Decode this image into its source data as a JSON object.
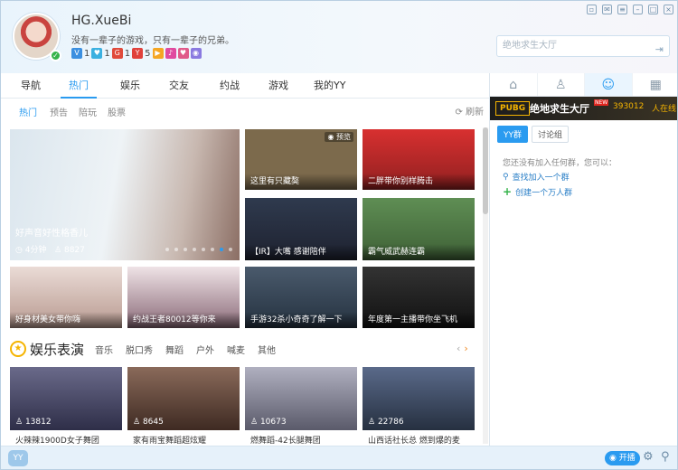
{
  "user": {
    "name": "HG.XueBi",
    "signature": "没有一辈子的游戏，只有一辈子的兄弟。",
    "badges": [
      "1",
      "1",
      "1",
      "5"
    ]
  },
  "search": {
    "placeholder": "绝地求生大厅"
  },
  "nav": {
    "items": [
      "导航",
      "热门",
      "娱乐",
      "交友",
      "约战",
      "游戏",
      "我的YY"
    ],
    "active": "热门"
  },
  "subnav": {
    "items": [
      "热门",
      "预告",
      "陪玩",
      "股票"
    ],
    "active": "热门",
    "refresh_label": "刷新"
  },
  "featured": {
    "title": "好声音好性格香儿",
    "duration": "4分钟",
    "viewers": "8827"
  },
  "tiles": [
    {
      "title": "这里有只藏獒",
      "tag": "预览",
      "color": "#7c6a4c"
    },
    {
      "title": "二胖带你别样腾击",
      "color": "#b03030"
    },
    {
      "title": "【IR】大嘴 感谢陪伴",
      "color": "#3a3f52"
    },
    {
      "title": "霸气威武赫连霸",
      "color": "#4f7a4a"
    },
    {
      "title": "好身材美女带你嗨",
      "color": "#c9a89c"
    },
    {
      "title": "约战王者80012等你来",
      "color": "#7a6a78"
    },
    {
      "title": "手游32杀小奇奇了解一下",
      "color": "#3a4a5c"
    },
    {
      "title": "年度第一主播带你坐飞机",
      "color": "#2b2b2b"
    }
  ],
  "section": {
    "title": "娱乐表演",
    "tabs": [
      "音乐",
      "脱口秀",
      "舞蹈",
      "户外",
      "喊麦",
      "其他"
    ]
  },
  "bottom_tiles": [
    {
      "title": "火辣辣1900D女子舞团",
      "viewers": "13812",
      "color": "#4a4a6a"
    },
    {
      "title": "家有雨宝舞蹈超炫耀",
      "viewers": "8645",
      "color": "#6a4a3a"
    },
    {
      "title": "燃舞蹈-42长腿舞团",
      "viewers": "10673",
      "color": "#7a7a8a"
    },
    {
      "title": "山西话社长总 燃到爆的麦",
      "viewers": "22786",
      "color": "#3a4a6a"
    }
  ],
  "right_panel": {
    "tabs": [
      "home-icon",
      "user-icon",
      "group-icon",
      "apps-icon"
    ],
    "banner": {
      "logo": "PUBG",
      "title": "绝地求生大厅",
      "new_tag": "NEW",
      "count": "393012",
      "online": "人在线"
    },
    "group_tabs": [
      "YY群",
      "讨论组"
    ],
    "empty_tip": "您还没有加入任何群，您可以：",
    "find_group": "查找加入一个群",
    "create_group": "创建一个万人群"
  },
  "bottom_bar": {
    "kaibo": "开播"
  },
  "colors": {
    "accent": "#2a9bf0",
    "online": "#35b34a",
    "banner_gold": "#f5b400"
  }
}
